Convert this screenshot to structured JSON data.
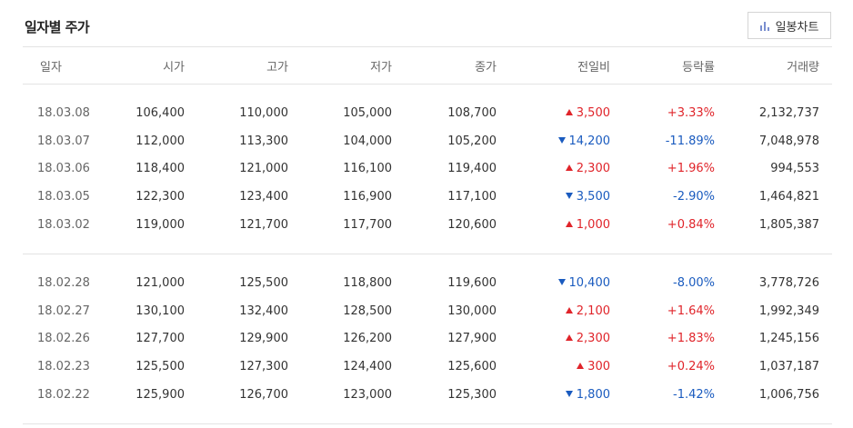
{
  "title": "일자별 주가",
  "chart_button": {
    "label": "일봉차트",
    "icon": "bar-chart-icon"
  },
  "colors": {
    "up": "#e0242a",
    "down": "#1a5bbf"
  },
  "columns": [
    "일자",
    "시가",
    "고가",
    "저가",
    "종가",
    "전일비",
    "등락률",
    "거래량"
  ],
  "groups": [
    {
      "rows": [
        {
          "date": "18.03.08",
          "open": "106,400",
          "high": "110,000",
          "low": "105,000",
          "close": "108,700",
          "dir": "up",
          "change": "3,500",
          "rate": "+3.33%",
          "volume": "2,132,737"
        },
        {
          "date": "18.03.07",
          "open": "112,000",
          "high": "113,300",
          "low": "104,000",
          "close": "105,200",
          "dir": "down",
          "change": "14,200",
          "rate": "-11.89%",
          "volume": "7,048,978"
        },
        {
          "date": "18.03.06",
          "open": "118,400",
          "high": "121,000",
          "low": "116,100",
          "close": "119,400",
          "dir": "up",
          "change": "2,300",
          "rate": "+1.96%",
          "volume": "994,553"
        },
        {
          "date": "18.03.05",
          "open": "122,300",
          "high": "123,400",
          "low": "116,900",
          "close": "117,100",
          "dir": "down",
          "change": "3,500",
          "rate": "-2.90%",
          "volume": "1,464,821"
        },
        {
          "date": "18.03.02",
          "open": "119,000",
          "high": "121,700",
          "low": "117,700",
          "close": "120,600",
          "dir": "up",
          "change": "1,000",
          "rate": "+0.84%",
          "volume": "1,805,387"
        }
      ]
    },
    {
      "rows": [
        {
          "date": "18.02.28",
          "open": "121,000",
          "high": "125,500",
          "low": "118,800",
          "close": "119,600",
          "dir": "down",
          "change": "10,400",
          "rate": "-8.00%",
          "volume": "3,778,726"
        },
        {
          "date": "18.02.27",
          "open": "130,100",
          "high": "132,400",
          "low": "128,500",
          "close": "130,000",
          "dir": "up",
          "change": "2,100",
          "rate": "+1.64%",
          "volume": "1,992,349"
        },
        {
          "date": "18.02.26",
          "open": "127,700",
          "high": "129,900",
          "low": "126,200",
          "close": "127,900",
          "dir": "up",
          "change": "2,300",
          "rate": "+1.83%",
          "volume": "1,245,156"
        },
        {
          "date": "18.02.23",
          "open": "125,500",
          "high": "127,300",
          "low": "124,400",
          "close": "125,600",
          "dir": "up",
          "change": "300",
          "rate": "+0.24%",
          "volume": "1,037,187"
        },
        {
          "date": "18.02.22",
          "open": "125,900",
          "high": "126,700",
          "low": "123,000",
          "close": "125,300",
          "dir": "down",
          "change": "1,800",
          "rate": "-1.42%",
          "volume": "1,006,756"
        }
      ]
    }
  ]
}
